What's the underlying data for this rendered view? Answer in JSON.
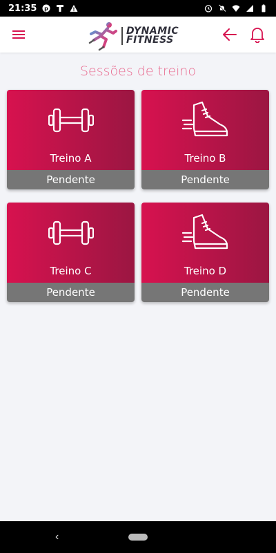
{
  "status_bar": {
    "time": "21:35",
    "left_icons": [
      "pinterest-icon",
      "t-notification-icon",
      "warning-icon"
    ],
    "right_icons": [
      "alarm-icon",
      "notifications-off-icon",
      "wifi-icon",
      "signal-icon",
      "battery-icon"
    ]
  },
  "header": {
    "menu_icon": "hamburger-menu-icon",
    "logo": {
      "line1": "DYNAMIC",
      "line2": "FITNESS"
    },
    "back_icon": "arrow-left-icon",
    "bell_icon": "bell-icon",
    "accent_color": "#d7124f"
  },
  "page": {
    "title": "Sessões de treino"
  },
  "sessions": [
    {
      "label": "Treino A",
      "status": "Pendente",
      "icon": "dumbbell-icon"
    },
    {
      "label": "Treino B",
      "status": "Pendente",
      "icon": "sneaker-icon"
    },
    {
      "label": "Treino C",
      "status": "Pendente",
      "icon": "dumbbell-icon"
    },
    {
      "label": "Treino D",
      "status": "Pendente",
      "icon": "sneaker-icon"
    }
  ],
  "nav_bar": {
    "back_icon": "nav-back-icon",
    "home_icon": "nav-home-pill-icon"
  }
}
